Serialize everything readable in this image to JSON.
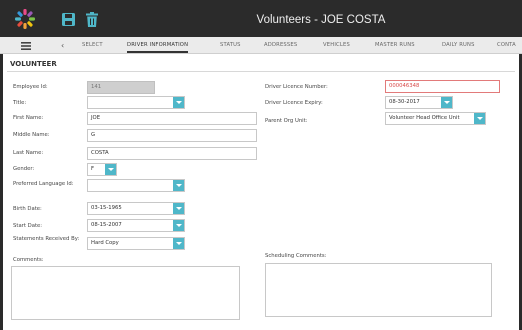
{
  "window": {
    "title": "Volunteers - JOE COSTA"
  },
  "icons": {
    "logo": "app-logo-icon",
    "save": "save-icon",
    "delete": "trash-icon",
    "menu": "menu-icon",
    "back": "chevron-left-icon"
  },
  "colors": {
    "accent": "#4fb7c9",
    "error": "#d84a4a",
    "topbar": "#2b2b2b"
  },
  "tabs": [
    {
      "label": "SELECT"
    },
    {
      "label": "DRIVER INFORMATION",
      "active": true
    },
    {
      "label": "STATUS"
    },
    {
      "label": "ADDRESSES"
    },
    {
      "label": "VEHICLES"
    },
    {
      "label": "MASTER RUNS"
    },
    {
      "label": "DAILY RUNS"
    },
    {
      "label": "CONTA"
    }
  ],
  "section": {
    "title": "VOLUNTEER"
  },
  "form": {
    "employee_id": {
      "label": "Employee Id:",
      "value": "141"
    },
    "title": {
      "label": "Title:",
      "value": ""
    },
    "first_name": {
      "label": "First Name:",
      "value": "JOE"
    },
    "middle_name": {
      "label": "Middle Name:",
      "value": "G"
    },
    "last_name": {
      "label": "Last Name:",
      "value": "COSTA"
    },
    "gender": {
      "label": "Gender:",
      "value": "F"
    },
    "preferred_language": {
      "label": "Preferred Language Id:",
      "value": ""
    },
    "birth_date": {
      "label": "Birth Date:",
      "value": "03-15-1965"
    },
    "start_date": {
      "label": "Start Date:",
      "value": "08-15-2007"
    },
    "statements": {
      "label": "Statements Received By:",
      "value": "Hard Copy"
    },
    "comments": {
      "label": "Comments:",
      "value": ""
    },
    "licence_number": {
      "label": "Driver Licence Number:",
      "value": "000046348"
    },
    "licence_expiry": {
      "label": "Driver Licence Expiry:",
      "value": "08-30-2017"
    },
    "parent_org": {
      "label": "Parent Org Unit:",
      "value": "Volunteer Head Office Unit"
    },
    "scheduling_comments": {
      "label": "Scheduling Comments:",
      "value": ""
    }
  }
}
